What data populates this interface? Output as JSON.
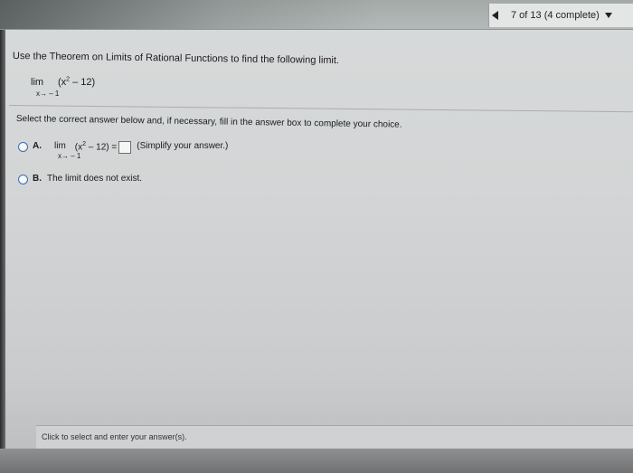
{
  "header": {
    "progress_text": "7 of 13 (4 complete)",
    "prev_icon": "triangle-left-icon",
    "dropdown_icon": "triangle-down-icon"
  },
  "question": {
    "instruction": "Use the Theorem on Limits of Rational Functions to find the following limit.",
    "lim_word": "lim",
    "lim_expression_base": "(x",
    "lim_expression_exp": "2",
    "lim_expression_tail": " – 12)",
    "lim_subscript": "x→ – 1"
  },
  "select_text": "Select the correct answer below and, if necessary, fill in the answer box to complete your choice.",
  "choices": [
    {
      "letter": "A.",
      "lim_word": "lim",
      "expr_base": "(x",
      "expr_exp": "2",
      "expr_tail": " – 12) =",
      "subscript": "x→ – 1",
      "answer_value": "",
      "hint": "(Simplify your answer.)"
    },
    {
      "letter": "B.",
      "text": "The limit does not exist."
    }
  ],
  "footer": {
    "text": "Click to select and enter your answer(s)."
  },
  "colors": {
    "radio_border": "#3b6fb0",
    "text": "#1b1b1b"
  }
}
